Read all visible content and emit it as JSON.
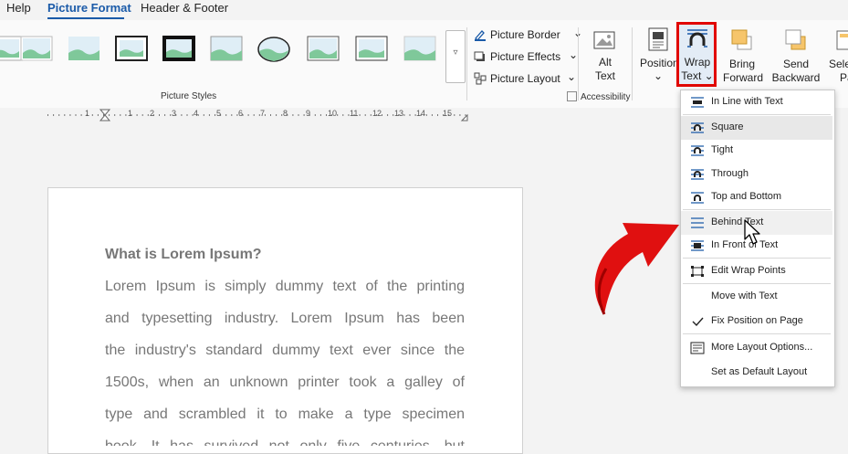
{
  "menubar": {
    "tabs": [
      {
        "label": "Help"
      },
      {
        "label": "Picture Format",
        "active": true
      },
      {
        "label": "Header & Footer"
      }
    ]
  },
  "ribbon": {
    "picture_styles_label": "Picture Styles",
    "commands": {
      "picture_border": "Picture Border",
      "picture_effects": "Picture Effects",
      "picture_layout": "Picture Layout"
    },
    "alt_text": {
      "line1": "Alt",
      "line2": "Text"
    },
    "accessibility_label": "Accessibility",
    "position": "Position",
    "wrap_text": {
      "line1": "Wrap",
      "line2": "Text"
    },
    "bring_forward": {
      "line1": "Bring",
      "line2": "Forward"
    },
    "send_backward": {
      "line1": "Send",
      "line2": "Backward"
    },
    "selection_pane": {
      "line1": "Sele",
      "line2": "Pa"
    },
    "accent_color": "#e10600"
  },
  "ruler": {
    "numbers": [
      "1",
      "1",
      "2",
      "3",
      "4",
      "5",
      "6",
      "7",
      "8",
      "9",
      "10",
      "11",
      "12",
      "13",
      "14",
      "15"
    ]
  },
  "document": {
    "heading": "What is Lorem Ipsum?",
    "lines": [
      "Lorem Ipsum is simply dummy text of the printing",
      "and typesetting industry. Lorem Ipsum has been",
      "the industry's standard dummy text ever since the",
      "1500s, when an unknown printer took a galley of",
      "type and scrambled it to make a type specimen",
      "book. It has survived not only five centuries, but"
    ]
  },
  "wrap_menu": {
    "items": [
      {
        "label": "In Line with Text",
        "icon": "inline-icon"
      },
      {
        "label": "Square",
        "icon": "square-wrap-icon",
        "state": "hover"
      },
      {
        "label": "Tight",
        "icon": "tight-wrap-icon"
      },
      {
        "label": "Through",
        "icon": "through-wrap-icon"
      },
      {
        "label": "Top and Bottom",
        "icon": "top-bottom-wrap-icon"
      },
      {
        "label": "Behind Text",
        "icon": "behind-text-icon",
        "state": "pointer"
      },
      {
        "label": "In Front of Text",
        "icon": "in-front-text-icon"
      },
      {
        "label": "Edit Wrap Points",
        "icon": "edit-wrap-points-icon"
      },
      {
        "label": "Move with Text",
        "icon": ""
      },
      {
        "label": "Fix Position on Page",
        "icon": "checkmark-icon",
        "checked": true
      },
      {
        "label": "More Layout Options...",
        "icon": "layout-options-icon"
      },
      {
        "label": "Set as Default Layout",
        "icon": ""
      }
    ]
  }
}
